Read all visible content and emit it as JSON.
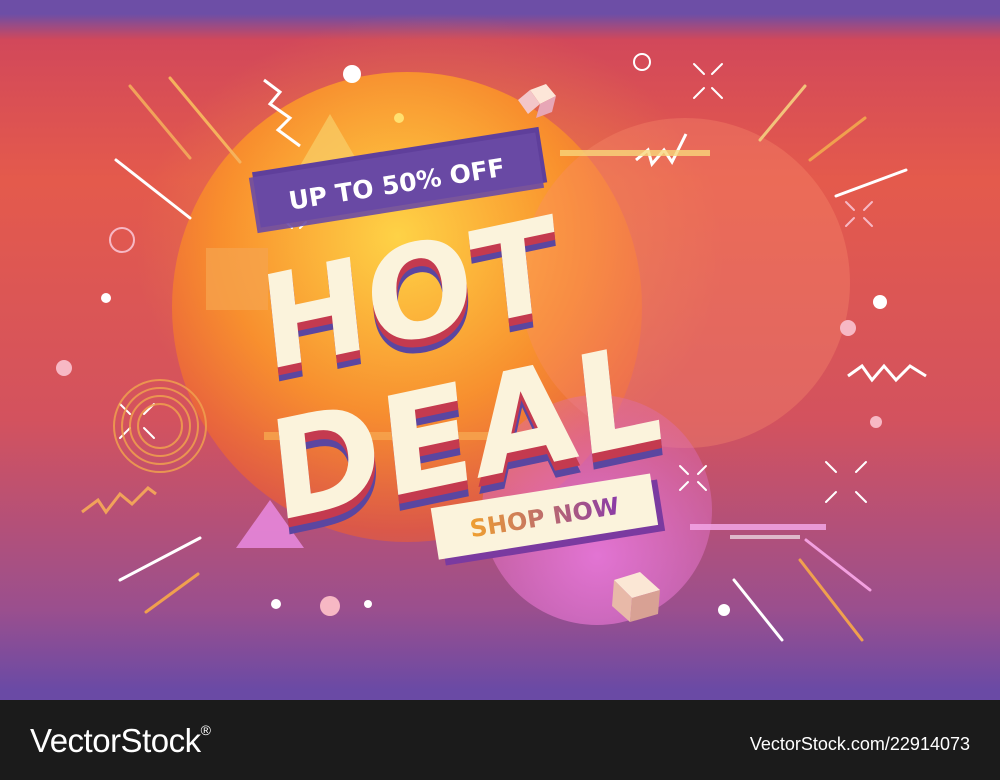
{
  "banner": {
    "promo_label": "UP TO 50% OFF",
    "headline_line1": "HOT",
    "headline_line2": "DEAL",
    "cta_label": "SHOP NOW",
    "colors": {
      "background_top": "#d2485a",
      "background_bottom": "#6a4aa5",
      "headline_fill": "#fbf3dc",
      "headline_shadow_red": "#c43a4f",
      "headline_shadow_purple": "#5b46a0",
      "promo_ribbon": "#6a4aa5",
      "cta_fill": "#fbf3dc",
      "cta_text_start": "#f0a030",
      "cta_text_end": "#8a3aa8"
    }
  },
  "footer": {
    "brand_name": "VectorStock",
    "registered_mark": "®",
    "image_id": "VectorStock.com/22914073"
  }
}
